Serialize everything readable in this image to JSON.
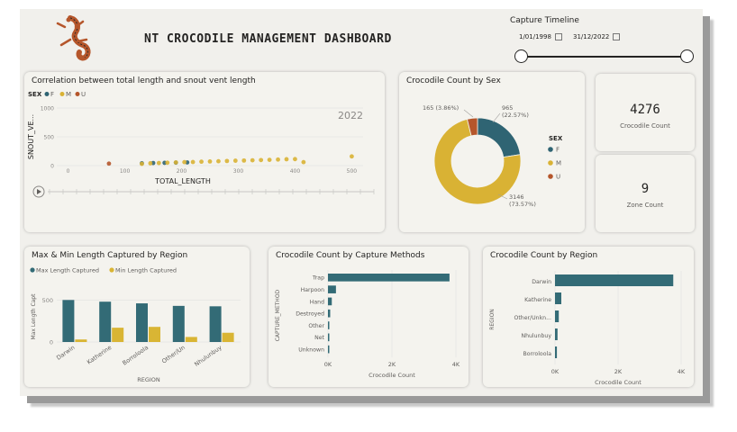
{
  "header": {
    "title": "NT CROCODILE MANAGEMENT DASHBOARD",
    "logo_icon": "crocodile-logo-icon"
  },
  "timeline": {
    "title": "Capture Timeline",
    "start": "1/01/1998",
    "end": "31/12/2022"
  },
  "colors": {
    "F": "#2f6473",
    "M": "#d9b234",
    "U": "#b5562b",
    "teal": "#336b76",
    "gold": "#d9b534"
  },
  "kpis": [
    {
      "value": "4276",
      "label": "Crocodile Count"
    },
    {
      "value": "9",
      "label": "Zone Count"
    }
  ],
  "chart_data": [
    {
      "type": "scatter",
      "title": "Correlation between total length and snout vent length",
      "xlabel": "TOTAL_LENGTH",
      "ylabel": "SNOUT_VE...",
      "legend_title": "SEX",
      "legend": [
        "F",
        "M",
        "U"
      ],
      "play_axis_value": "2022",
      "xlim": [
        -20,
        520
      ],
      "ylim": [
        0,
        1000
      ],
      "xticks": [
        0,
        100,
        200,
        300,
        400,
        500
      ],
      "yticks": [
        0,
        500,
        1000
      ],
      "series": [
        {
          "name": "F",
          "x": [
            130,
            150,
            170,
            190,
            210
          ],
          "y": [
            40,
            45,
            48,
            52,
            55
          ]
        },
        {
          "name": "M",
          "x": [
            130,
            145,
            160,
            175,
            190,
            205,
            220,
            235,
            250,
            265,
            280,
            295,
            310,
            325,
            340,
            355,
            370,
            385,
            400,
            415,
            500
          ],
          "y": [
            30,
            40,
            45,
            50,
            55,
            60,
            62,
            68,
            72,
            76,
            80,
            85,
            88,
            92,
            96,
            100,
            105,
            110,
            112,
            60,
            160
          ]
        },
        {
          "name": "U",
          "x": [
            72
          ],
          "y": [
            35
          ]
        }
      ]
    },
    {
      "type": "pie",
      "title": "Crocodile Count by Sex",
      "legend_title": "SEX",
      "labels": [
        "F",
        "M",
        "U"
      ],
      "values": [
        965,
        3146,
        165
      ],
      "data_labels": [
        "965\n(22.57%)",
        "3146\n(73.57%)",
        "165 (3.86%)"
      ]
    },
    {
      "type": "bar",
      "title": "Max & Min Length Captured by Region",
      "xlabel": "REGION",
      "ylabel": "Max Length Capt",
      "categories": [
        "Darwin",
        "Katherine",
        "Borroloola",
        "Other/Un",
        "Nhulunbuy"
      ],
      "series": [
        {
          "name": "Max Length Captured",
          "values": [
            500,
            480,
            460,
            430,
            425
          ]
        },
        {
          "name": "Min Length Captured",
          "values": [
            30,
            170,
            180,
            60,
            110
          ]
        }
      ],
      "ylim": [
        0,
        600
      ],
      "yticks": [
        0,
        500
      ]
    },
    {
      "type": "bar",
      "orientation": "horizontal",
      "title": "Crocodile Count by Capture Methods",
      "xlabel": "Crocodile Count",
      "ylabel": "CAPTURE_METHOD",
      "categories": [
        "Trap",
        "Harpoon",
        "Hand",
        "Destroyed",
        "Other",
        "Net",
        "Unknown"
      ],
      "values": [
        3800,
        250,
        120,
        70,
        25,
        15,
        10
      ],
      "xlim": [
        0,
        4000
      ],
      "xticks": [
        "0K",
        "2K",
        "4K"
      ]
    },
    {
      "type": "bar",
      "orientation": "horizontal",
      "title": "Crocodile Count by Region",
      "xlabel": "Crocodile Count",
      "ylabel": "REGION",
      "categories": [
        "Darwin",
        "Katherine",
        "Other/Unkn...",
        "Nhulunbuy",
        "Borroloola"
      ],
      "values": [
        3750,
        200,
        120,
        80,
        60
      ],
      "xlim": [
        0,
        4000
      ],
      "xticks": [
        "0K",
        "2K",
        "4K"
      ]
    }
  ]
}
